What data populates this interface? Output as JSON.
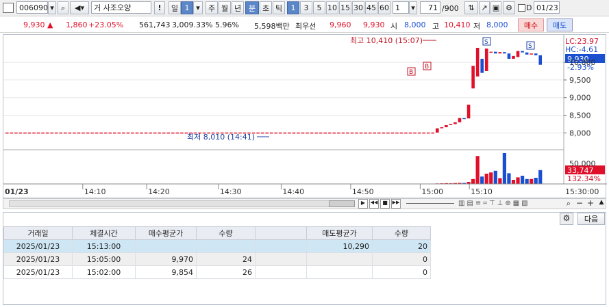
{
  "toolbar": {
    "stock_code": "006090",
    "market_tag": "거",
    "stock_name": "사조오양",
    "period_buttons": [
      "일",
      "1",
      "주",
      "월",
      "년",
      "분",
      "초",
      "틱"
    ],
    "interval_buttons": [
      "1",
      "3",
      "5",
      "10",
      "15",
      "30",
      "45",
      "60"
    ],
    "unit_value": "1",
    "count": "71",
    "count_total": "/900",
    "date_value": "01/23",
    "date_check_label": "D",
    "alert_label": "!"
  },
  "quote": {
    "price": "9,930",
    "change": "1,860",
    "change_pct": "+23.05%",
    "volume": "561,743",
    "volume_ratio": "3,009.33%",
    "turnover": "5.96%",
    "amount": "5,598백만",
    "best_label": "최우선",
    "best_ask": "9,960",
    "best_bid": "9,930",
    "open_label": "시",
    "open": "8,000",
    "high_label": "고",
    "high": "10,410",
    "low_label": "저",
    "low": "8,000",
    "buy_label": "매수",
    "sell_label": "매도"
  },
  "chart": {
    "high_annotation": "최고 10,410 (15:07)",
    "low_annotation": "최저 8,010 (14:41)",
    "lc_label": "LC:23.97",
    "hc_label": "HC:-4.61",
    "price_badge": "9,930",
    "price_pct": "-2.93%",
    "volume_badge": "33,747",
    "volume_pct": "132.34%",
    "date_corner": "01/23",
    "markers": {
      "buy": "B",
      "sell": "S"
    },
    "colors": {
      "up": "#e0102a",
      "down": "#1a4fd0",
      "accent": "#2a5db0"
    }
  },
  "chart_data": {
    "type": "candlestick",
    "price_axis": {
      "ticks": [
        "10,000",
        "9,500",
        "9,000",
        "8,500",
        "8,000"
      ],
      "range": [
        7600,
        10700
      ]
    },
    "volume_axis": {
      "ticks": [
        "50,000"
      ],
      "range": [
        0,
        80000
      ]
    },
    "time_axis": {
      "ticks": [
        "14:10",
        "14:20",
        "14:30",
        "14:40",
        "14:50",
        "15:00",
        "15:10",
        "15:30:00"
      ]
    },
    "candles": [
      {
        "o": 8010,
        "c": 8010
      },
      {
        "o": 8010,
        "c": 8010
      },
      {
        "o": 8010,
        "c": 8010
      },
      {
        "o": 8010,
        "c": 8010
      },
      {
        "o": 8010,
        "c": 8010
      },
      {
        "o": 8010,
        "c": 8010
      },
      {
        "o": 8010,
        "c": 8010
      },
      {
        "o": 8010,
        "c": 8010
      },
      {
        "o": 8010,
        "c": 8010
      },
      {
        "o": 8010,
        "c": 8010
      },
      {
        "o": 8010,
        "c": 8010
      },
      {
        "o": 8010,
        "c": 8010
      },
      {
        "o": 8010,
        "c": 8010
      },
      {
        "o": 8010,
        "c": 8010
      },
      {
        "o": 8010,
        "c": 8010
      },
      {
        "o": 8010,
        "c": 8010
      },
      {
        "o": 8010,
        "c": 8010
      },
      {
        "o": 8010,
        "c": 8010
      },
      {
        "o": 8010,
        "c": 8010
      },
      {
        "o": 8010,
        "c": 8010
      },
      {
        "o": 8010,
        "c": 8010
      },
      {
        "o": 8010,
        "c": 8010
      },
      {
        "o": 8010,
        "c": 8010
      },
      {
        "o": 8010,
        "c": 8010
      },
      {
        "o": 8010,
        "c": 8010
      },
      {
        "o": 8010,
        "c": 8010
      },
      {
        "o": 8010,
        "c": 8010
      },
      {
        "o": 8010,
        "c": 8010
      },
      {
        "o": 8010,
        "c": 8010
      },
      {
        "o": 8010,
        "c": 8010
      },
      {
        "o": 8010,
        "c": 8010
      },
      {
        "o": 8010,
        "c": 8010
      },
      {
        "o": 8010,
        "c": 8010
      },
      {
        "o": 8010,
        "c": 8010
      },
      {
        "o": 8010,
        "c": 8010
      },
      {
        "o": 8010,
        "c": 8010
      },
      {
        "o": 8010,
        "c": 8010
      },
      {
        "o": 8010,
        "c": 8010
      },
      {
        "o": 8010,
        "c": 8010
      },
      {
        "o": 8010,
        "c": 8010
      },
      {
        "o": 8010,
        "c": 8010
      },
      {
        "o": 8010,
        "c": 8010
      },
      {
        "o": 8010,
        "c": 8010
      },
      {
        "o": 8010,
        "c": 8010
      },
      {
        "o": 8010,
        "c": 8010
      },
      {
        "o": 8010,
        "c": 8010
      },
      {
        "o": 8010,
        "c": 8010
      },
      {
        "o": 8010,
        "c": 8010
      },
      {
        "o": 8010,
        "c": 8010
      },
      {
        "o": 8010,
        "c": 8010
      },
      {
        "o": 8010,
        "c": 8010
      },
      {
        "o": 8010,
        "c": 8010
      },
      {
        "o": 8010,
        "c": 8010
      },
      {
        "o": 8010,
        "c": 8010
      },
      {
        "o": 8010,
        "c": 8010
      },
      {
        "o": 8010,
        "c": 8010
      },
      {
        "o": 8010,
        "c": 8010
      },
      {
        "o": 8010,
        "c": 8010
      },
      {
        "o": 8010,
        "c": 8010
      },
      {
        "o": 8010,
        "c": 8010
      },
      {
        "o": 8010,
        "c": 8010
      },
      {
        "o": 8010,
        "c": 8010
      },
      {
        "o": 8010,
        "c": 8010
      },
      {
        "o": 8010,
        "c": 8010
      },
      {
        "o": 8010,
        "c": 8010
      },
      {
        "o": 8010,
        "c": 8010
      },
      {
        "o": 8010,
        "c": 8010
      },
      {
        "o": 8010,
        "c": 8010
      },
      {
        "o": 8010,
        "c": 8010
      },
      {
        "o": 8010,
        "c": 8010
      },
      {
        "o": 8010,
        "c": 8010
      },
      {
        "o": 8010,
        "c": 8010
      },
      {
        "o": 8010,
        "c": 8010
      },
      {
        "o": 8010,
        "c": 8010
      },
      {
        "o": 8010,
        "c": 8010
      },
      {
        "o": 8010,
        "c": 8010
      },
      {
        "o": 8010,
        "c": 8010
      },
      {
        "o": 8010,
        "c": 8010
      },
      {
        "o": 8010,
        "c": 8010
      },
      {
        "o": 8010,
        "c": 8010
      },
      {
        "o": 8010,
        "c": 8010
      },
      {
        "o": 8010,
        "c": 8010
      },
      {
        "o": 8010,
        "c": 8010
      },
      {
        "o": 8010,
        "c": 8010
      },
      {
        "o": 8010,
        "c": 8010
      },
      {
        "o": 8010,
        "c": 8010
      },
      {
        "o": 8010,
        "c": 8010
      },
      {
        "o": 8010,
        "c": 8010
      },
      {
        "o": 8010,
        "c": 8010
      },
      {
        "o": 8010,
        "c": 8010
      },
      {
        "o": 8010,
        "c": 8010
      },
      {
        "o": 8010,
        "c": 8010
      },
      {
        "o": 8010,
        "c": 8010
      },
      {
        "o": 8010,
        "c": 8010
      },
      {
        "o": 8010,
        "c": 8010
      },
      {
        "o": 8010,
        "c": 8010
      },
      {
        "o": 8010,
        "c": 8130
      },
      {
        "o": 8130,
        "c": 8160
      },
      {
        "o": 8160,
        "c": 8220
      },
      {
        "o": 8220,
        "c": 8250
      },
      {
        "o": 8250,
        "c": 8300
      },
      {
        "o": 8300,
        "c": 8420
      },
      {
        "o": 8420,
        "c": 8410
      },
      {
        "o": 8410,
        "c": 8800
      },
      {
        "o": 9260,
        "c": 9900
      },
      {
        "o": 9600,
        "c": 10410
      },
      {
        "o": 10100,
        "c": 9700
      },
      {
        "o": 9750,
        "c": 10390
      },
      {
        "o": 10300,
        "c": 10300
      },
      {
        "o": 10300,
        "c": 10250
      },
      {
        "o": 10250,
        "c": 10290
      },
      {
        "o": 10290,
        "c": 10250
      },
      {
        "o": 10250,
        "c": 10100
      },
      {
        "o": 10100,
        "c": 10180
      },
      {
        "o": 10150,
        "c": 10320
      },
      {
        "o": 10320,
        "c": 10280
      },
      {
        "o": 10280,
        "c": 10220
      },
      {
        "o": 10220,
        "c": 10250
      },
      {
        "o": 10250,
        "c": 10200
      },
      {
        "o": 10200,
        "c": 9930
      }
    ],
    "volume": [
      200,
      200,
      200,
      200,
      200,
      200,
      200,
      200,
      200,
      200,
      200,
      200,
      200,
      200,
      200,
      200,
      200,
      200,
      200,
      200,
      200,
      200,
      200,
      200,
      200,
      200,
      200,
      200,
      200,
      200,
      200,
      200,
      200,
      200,
      200,
      200,
      200,
      200,
      200,
      200,
      200,
      200,
      200,
      200,
      200,
      200,
      200,
      200,
      200,
      200,
      200,
      200,
      200,
      200,
      200,
      200,
      200,
      200,
      200,
      200,
      200,
      200,
      200,
      200,
      200,
      200,
      200,
      200,
      200,
      200,
      200,
      200,
      200,
      200,
      200,
      200,
      200,
      200,
      200,
      200,
      200,
      200,
      200,
      200,
      200,
      200,
      200,
      200,
      200,
      200,
      200,
      200,
      200,
      200,
      200,
      200,
      1200,
      1500,
      1800,
      1600,
      2200,
      2600,
      2400,
      5000,
      12000,
      68000,
      18000,
      25000,
      28000,
      32000,
      14000,
      75000,
      26000,
      10000,
      16000,
      20000,
      12000,
      12000,
      15000,
      33747
    ]
  },
  "navigator": {
    "buttons": [
      "▶",
      "◀◀",
      "■",
      "▶▶"
    ],
    "zoom_buttons": [
      "−",
      "+",
      "▲"
    ]
  },
  "trades": {
    "next_label": "다음",
    "columns": [
      "거래일",
      "체결시간",
      "매수평균가",
      "수량",
      "",
      "매도평균가",
      "수량"
    ],
    "rows": [
      [
        "2025/01/23",
        "15:13:00",
        "",
        "",
        "",
        "10,290",
        "20"
      ],
      [
        "2025/01/23",
        "15:05:00",
        "9,970",
        "24",
        "",
        "",
        "0"
      ],
      [
        "2025/01/23",
        "15:02:00",
        "9,854",
        "26",
        "",
        "",
        "0"
      ]
    ]
  }
}
